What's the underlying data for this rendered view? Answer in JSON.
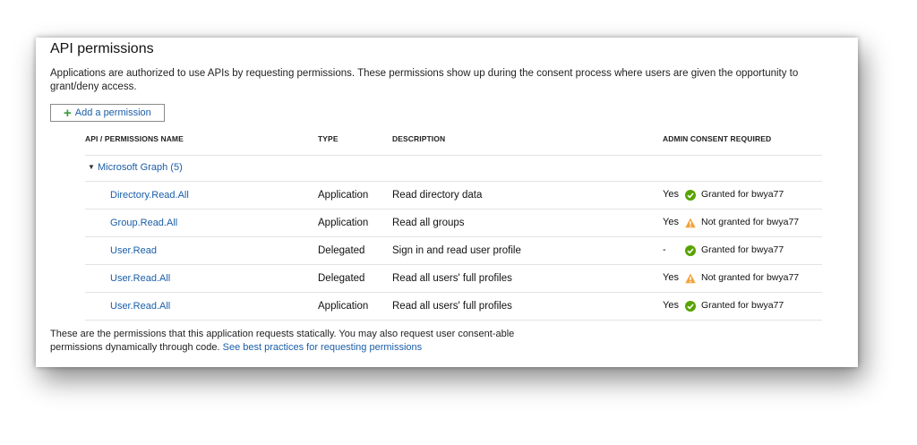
{
  "panel": {
    "title": "API permissions",
    "intro": "Applications are authorized to use APIs by requesting permissions. These permissions show up during the consent process where users are given the opportunity to grant/deny access.",
    "add_button_label": "Add a permission"
  },
  "table": {
    "headers": {
      "name": "API / PERMISSIONS NAME",
      "type": "TYPE",
      "description": "DESCRIPTION",
      "admin_consent": "ADMIN CONSENT REQUIRED"
    },
    "group": {
      "label": "Microsoft Graph (5)",
      "expanded_icon": "caret-down-icon"
    },
    "rows": [
      {
        "name": "Directory.Read.All",
        "type": "Application",
        "description": "Read directory data",
        "consent": "Yes",
        "status": "granted",
        "status_text": "Granted for bwya77"
      },
      {
        "name": "Group.Read.All",
        "type": "Application",
        "description": "Read all groups",
        "consent": "Yes",
        "status": "warning",
        "status_text": "Not granted for bwya77"
      },
      {
        "name": "User.Read",
        "type": "Delegated",
        "description": "Sign in and read user profile",
        "consent": "-",
        "status": "granted",
        "status_text": "Granted for bwya77"
      },
      {
        "name": "User.Read.All",
        "type": "Delegated",
        "description": "Read all users' full profiles",
        "consent": "Yes",
        "status": "warning",
        "status_text": "Not granted for bwya77"
      },
      {
        "name": "User.Read.All",
        "type": "Application",
        "description": "Read all users' full profiles",
        "consent": "Yes",
        "status": "granted",
        "status_text": "Granted for bwya77"
      }
    ]
  },
  "footer": {
    "text": "These are the permissions that this application requests statically. You may also request user consent-able permissions dynamically through code.",
    "link_text": "See best practices for requesting permissions"
  },
  "colors": {
    "link": "#1a5ea8",
    "granted": "#57a300",
    "warning": "#f2a33a",
    "add_plus": "#3a9b3a"
  }
}
